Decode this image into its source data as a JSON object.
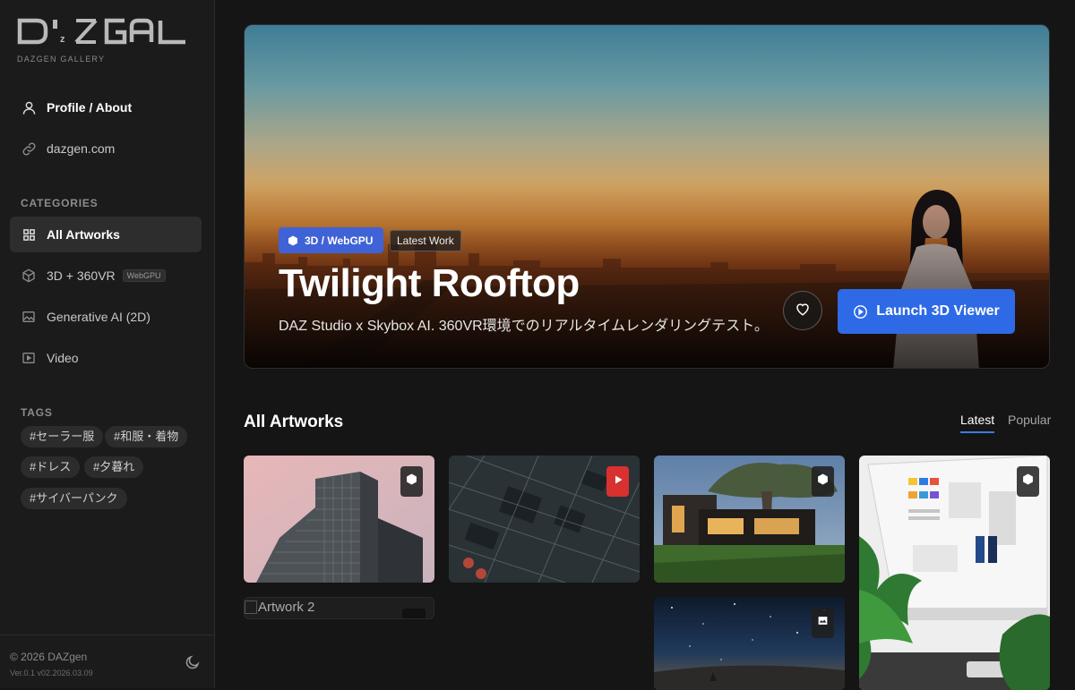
{
  "app": {
    "logo_text": "D'zGAL",
    "subtitle": "DAZGEN GALLERY"
  },
  "sidebar": {
    "links": [
      {
        "label": "Profile / About",
        "icon": "user-icon"
      },
      {
        "label": "dazgen.com",
        "icon": "link-icon"
      }
    ],
    "categories_title": "CATEGORIES",
    "categories": [
      {
        "label": "All Artworks",
        "icon": "grid-icon",
        "active": true
      },
      {
        "label": "3D + 360VR",
        "icon": "cube-icon",
        "badge": "WebGPU"
      },
      {
        "label": "Generative AI (2D)",
        "icon": "image-icon"
      },
      {
        "label": "Video",
        "icon": "video-icon"
      }
    ],
    "tags_title": "TAGS",
    "tags": [
      "#セーラー服",
      "#和服・着物",
      "#ドレス",
      "#夕暮れ",
      "#サイバーパンク"
    ],
    "footer": {
      "copyright": "© 2026 DAZgen",
      "version": "Ver.0.1 v02.2026.03.09",
      "theme_icon": "moon-icon"
    }
  },
  "hero": {
    "badge_primary": "3D / WebGPU",
    "badge_secondary": "Latest Work",
    "title": "Twilight Rooftop",
    "description": "DAZ Studio x Skybox AI. 360VR環境でのリアルタイムレンダリングテスト。",
    "favorite_icon": "heart-icon",
    "launch_label": "Launch 3D Viewer",
    "launch_icon": "play-circle-icon"
  },
  "gallery": {
    "heading": "All Artworks",
    "sort_tabs": [
      {
        "label": "Latest",
        "active": true
      },
      {
        "label": "Popular",
        "active": false
      }
    ],
    "cards": [
      {
        "kind": "3D",
        "badge_icon": "cube-icon",
        "subject": "skyscraper"
      },
      {
        "kind": "video",
        "badge_icon": "play-icon",
        "subject": "circuit-board"
      },
      {
        "kind": "3D",
        "badge_icon": "cube-icon",
        "subject": "modern-house"
      },
      {
        "kind": "3D",
        "badge_icon": "cube-icon",
        "subject": "desktop-workspace"
      },
      {
        "kind": "broken",
        "alt": "Artwork 2"
      },
      {
        "kind": "image",
        "badge_icon": "image-icon",
        "subject": "night-sky"
      }
    ]
  },
  "colors": {
    "accent": "#2e6ae6",
    "chip_blue": "#3f63d6",
    "video_red": "#d93030",
    "background": "#151515",
    "sidebar": "#1b1b1b"
  }
}
